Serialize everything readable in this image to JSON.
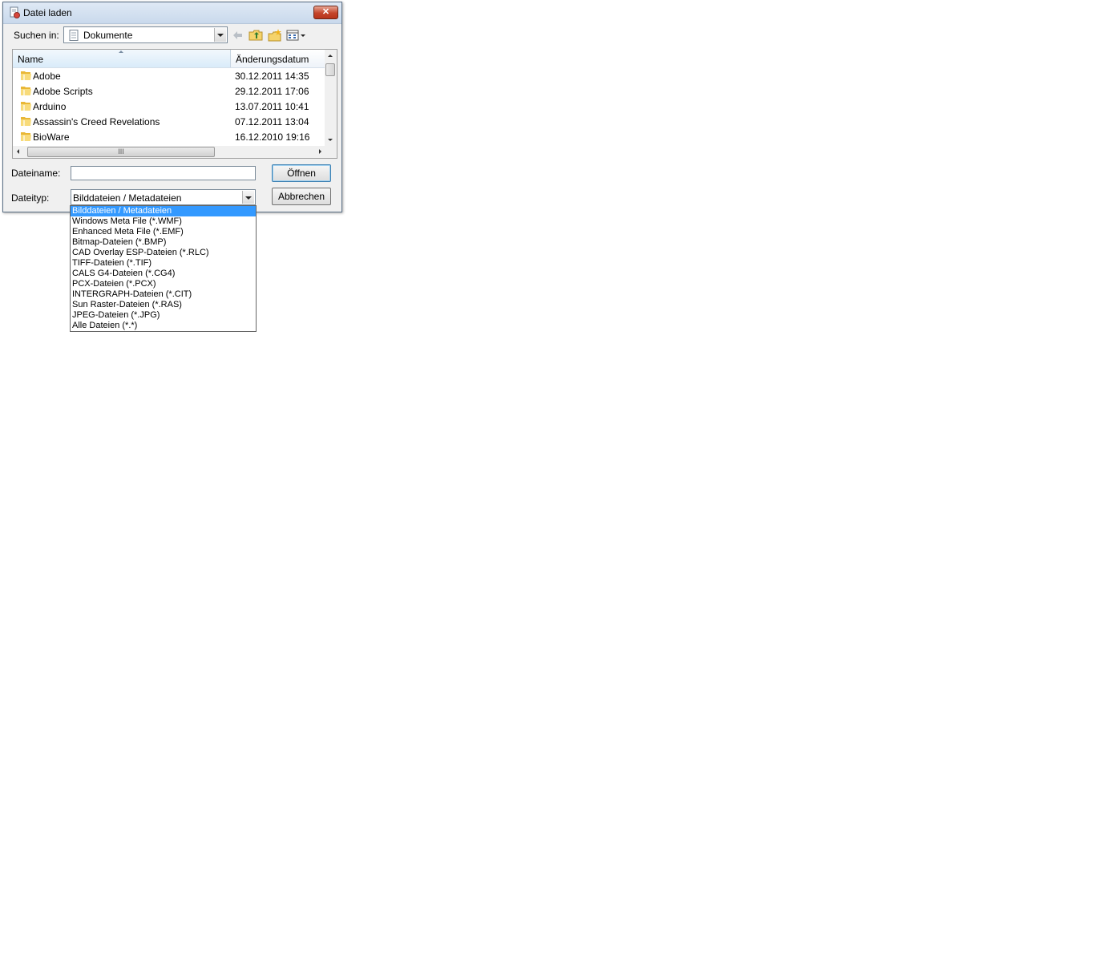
{
  "window": {
    "title": "Datei laden",
    "close_label": "✕"
  },
  "toolbar": {
    "look_in_label": "Suchen in:",
    "look_in_value": "Dokumente"
  },
  "file_list": {
    "columns": {
      "name": "Name",
      "date": "Änderungsdatum"
    },
    "rows": [
      {
        "name": "Adobe",
        "date": "30.12.2011 14:35"
      },
      {
        "name": "Adobe Scripts",
        "date": "29.12.2011 17:06"
      },
      {
        "name": "Arduino",
        "date": "13.07.2011 10:41"
      },
      {
        "name": "Assassin's Creed Revelations",
        "date": "07.12.2011 13:04"
      },
      {
        "name": "BioWare",
        "date": "16.12.2010 19:16"
      }
    ],
    "hscroll_grip": "III"
  },
  "form": {
    "filename_label": "Dateiname:",
    "filename_value": "",
    "filetype_label": "Dateityp:",
    "filetype_value": "Bilddateien / Metadateien",
    "open_label": "Öffnen",
    "cancel_label": "Abbrechen"
  },
  "filetype_options": [
    "Bilddateien / Metadateien",
    "Windows Meta File (*.WMF)",
    "Enhanced Meta File (*.EMF)",
    "Bitmap-Dateien (*.BMP)",
    "CAD Overlay ESP-Dateien (*.RLC)",
    "TIFF-Dateien (*.TIF)",
    "CALS G4-Dateien (*.CG4)",
    "PCX-Dateien (*.PCX)",
    "INTERGRAPH-Dateien (*.CIT)",
    "Sun Raster-Dateien (*.RAS)",
    "JPEG-Dateien (*.JPG)",
    "Alle Dateien (*.*)"
  ],
  "icons": {
    "title": "file-open-icon",
    "back": "back-arrow-icon",
    "up": "up-folder-icon",
    "new_folder": "new-folder-icon",
    "view": "view-menu-icon",
    "folder": "folder-icon"
  },
  "colors": {
    "selection": "#3399ff",
    "close": "#c4452b"
  }
}
